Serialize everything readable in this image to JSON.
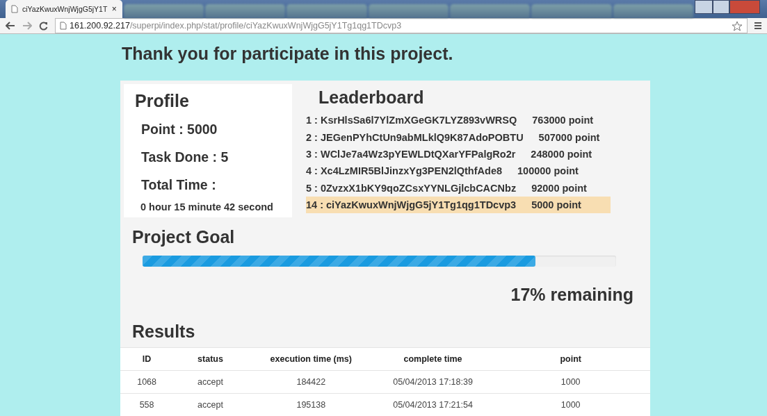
{
  "browser": {
    "tabs": [
      {
        "title": "ciYazKwuxWnjWjgG5jY1T",
        "selected": true,
        "close": "×"
      },
      {
        "selected": false
      },
      {
        "selected": false
      },
      {
        "selected": false
      },
      {
        "selected": false
      },
      {
        "selected": false
      },
      {
        "selected": false
      },
      {
        "selected": false
      }
    ],
    "url_host": "161.200.92.217",
    "url_path": "/superpi/index.php/stat/profile/ciYazKwuxWnjWjgG5jY1Tg1qg1TDcvp3"
  },
  "heading": "Thank you for participate in this project.",
  "profile": {
    "title": "Profile",
    "point": "Point : 5000",
    "task_done": "Task Done : 5",
    "total_time_label": "Total Time :",
    "total_time": "0 hour 15 minute 42 second"
  },
  "leaderboard": {
    "title": "Leaderboard",
    "entries": [
      {
        "rank": "1 : KsrHlsSa6l7YlZmXGeGK7LYZ893vWRSQ",
        "points": "763000 point",
        "selected": false
      },
      {
        "rank": "2 : JEGenPYhCtUn9abMLklQ9K87AdoPOBTU",
        "points": "507000 point",
        "selected": false
      },
      {
        "rank": "3 : WClJe7a4Wz3pYEWLDtQXarYFPalgRo2r",
        "points": "248000 point",
        "selected": false
      },
      {
        "rank": "4 : Xc4LzMIR5BlJinzxYg3PEN2lQthfAde8",
        "points": "100000 point",
        "selected": false
      },
      {
        "rank": "5 : 0ZvzxX1bKY9qoZCsxYYNLGjlcbCACNbz",
        "points": "92000 point",
        "selected": false
      },
      {
        "rank": "14 : ciYazKwuxWnjWjgG5jY1Tg1qg1TDcvp3",
        "points": "5000 point",
        "selected": true
      }
    ]
  },
  "goal": {
    "title": "Project Goal",
    "level": 0.83,
    "remaining": "17% remaining"
  },
  "results": {
    "title": "Results",
    "columns": [
      "ID",
      "status",
      "execution time (ms)",
      "complete time",
      "point"
    ],
    "rows": [
      [
        "1068",
        "accept",
        "184422",
        "05/04/2013 17:18:39",
        "1000"
      ],
      [
        "558",
        "accept",
        "195138",
        "05/04/2013 17:21:54",
        "1000"
      ]
    ]
  }
}
